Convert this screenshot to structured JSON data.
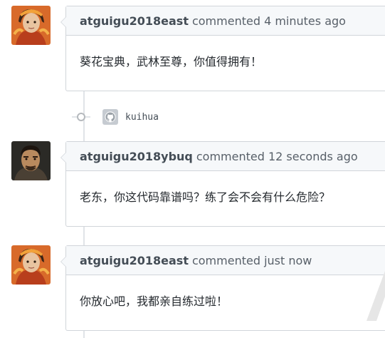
{
  "comments": [
    {
      "author": "atguigu2018east",
      "meta": "commented 4 minutes ago",
      "body": "葵花宝典，武林至尊，你值得拥有！"
    },
    {
      "author": "atguigu2018ybuq",
      "meta": "commented 12 seconds ago",
      "body": "老东，你这代码靠谱吗？练了会不会有什么危险？"
    },
    {
      "author": "atguigu2018east",
      "meta": "commented just now",
      "body": "你放心吧，我都亲自练过啦！"
    }
  ],
  "commit": {
    "message": "kuihua",
    "avatar_icon": "github-octocat-icon"
  },
  "colors": {
    "border": "#d1d5da",
    "header_bg": "#f6f8fa",
    "timeline": "#e1e4e8"
  }
}
